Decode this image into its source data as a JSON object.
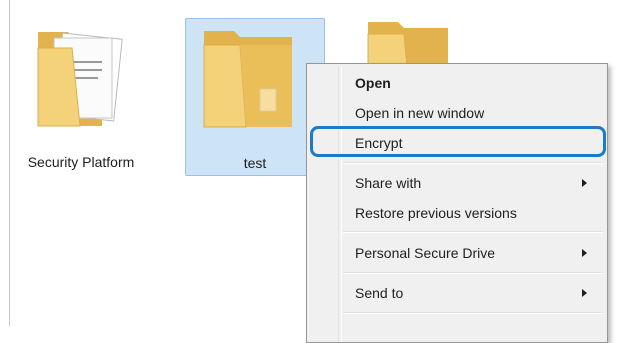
{
  "folders": [
    {
      "name": "Security Platform",
      "icon": "folder-with-documents-icon",
      "selected": false
    },
    {
      "name": "test",
      "icon": "folder-icon",
      "selected": true
    },
    {
      "name": "",
      "icon": "folder-icon",
      "selected": false
    }
  ],
  "context_menu": {
    "items": [
      {
        "label": "Open",
        "bold": true,
        "submenu": false
      },
      {
        "label": "Open in new window",
        "bold": false,
        "submenu": false
      },
      {
        "label": "Encrypt",
        "bold": false,
        "submenu": false,
        "highlighted": true
      },
      {
        "label": "Share with",
        "bold": false,
        "submenu": true
      },
      {
        "label": "Restore previous versions",
        "bold": false,
        "submenu": false
      },
      {
        "label": "Personal Secure Drive",
        "bold": false,
        "submenu": true
      },
      {
        "label": "Send to",
        "bold": false,
        "submenu": true
      }
    ]
  },
  "colors": {
    "selection_fill": "#cde4f7",
    "selection_border": "#99c3e8",
    "highlight_ring": "#1b7bc9",
    "folder_body": "#f3d27a",
    "folder_back": "#e2b24d"
  }
}
